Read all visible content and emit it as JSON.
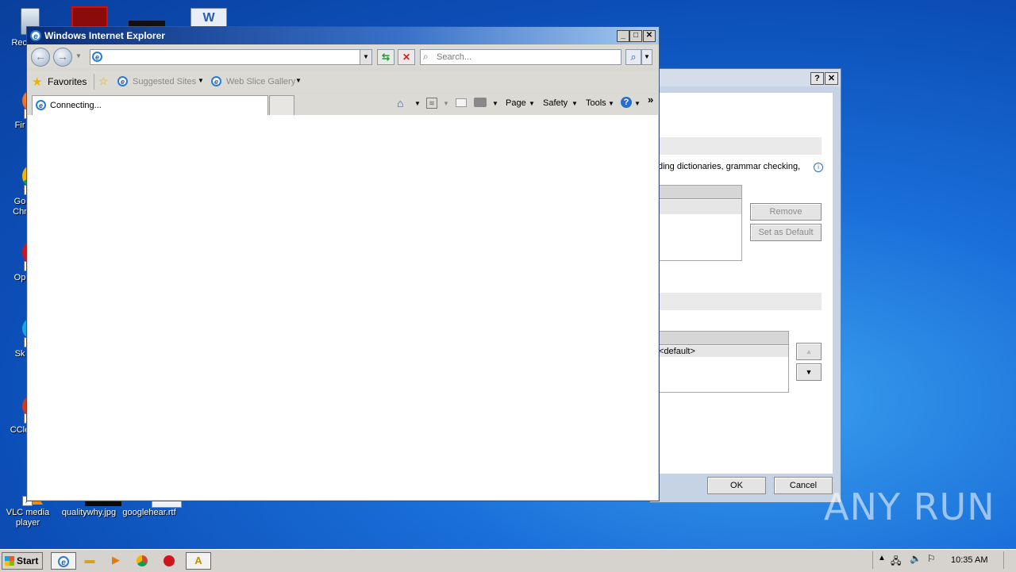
{
  "desktop": {
    "icons": [
      {
        "label": "Recy",
        "name": "recycle-bin"
      },
      {
        "label": "Fir",
        "name": "firefox"
      },
      {
        "label": "Go\nChr",
        "name": "google-chrome"
      },
      {
        "label": "Op",
        "name": "opera"
      },
      {
        "label": "Sk",
        "name": "skype"
      },
      {
        "label": "CCle",
        "name": "ccleaner"
      },
      {
        "label": "VLC media player",
        "name": "vlc"
      },
      {
        "label": "qualitywhy.jpg",
        "name": "qualitywhy-file"
      },
      {
        "label": "googlehear.rtf",
        "name": "googlehear-file"
      }
    ],
    "watermark": "ANY RUN"
  },
  "dialog": {
    "help_label": "?",
    "close_label": "✕",
    "description": "ding dictionaries, grammar checking,",
    "info_icon": "i",
    "remove_label": "Remove",
    "set_default_label": "Set as Default",
    "list_item": "<default>",
    "up_arrow": "▲",
    "down_arrow": "▼",
    "ok_label": "OK",
    "cancel_label": "Cancel"
  },
  "ie": {
    "title": "Windows Internet Explorer",
    "minimize": "_",
    "maximize": "□",
    "close": "✕",
    "address_value": "",
    "search_placeholder": "Search...",
    "favorites_label": "Favorites",
    "suggested_sites": "Suggested Sites",
    "web_slice_gallery": "Web Slice Gallery",
    "tab_label": "Connecting...",
    "page_menu": "Page",
    "safety_menu": "Safety",
    "tools_menu": "Tools",
    "chevron": "»"
  },
  "taskbar": {
    "start_label": "Start",
    "clock": "10:35 AM"
  }
}
